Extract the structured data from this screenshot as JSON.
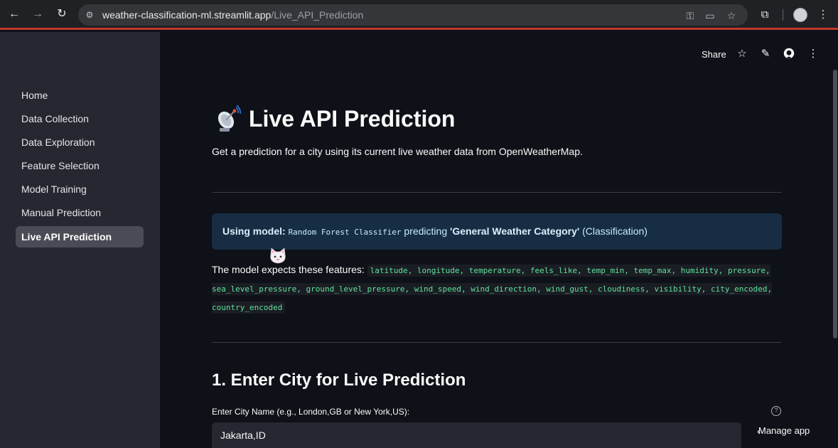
{
  "browser": {
    "url_host": "weather-classification-ml.streamlit.app",
    "url_path": "/Live_API_Prediction"
  },
  "sidebar": {
    "items": [
      {
        "label": "Home"
      },
      {
        "label": "Data Collection"
      },
      {
        "label": "Data Exploration"
      },
      {
        "label": "Feature Selection"
      },
      {
        "label": "Model Training"
      },
      {
        "label": "Manual Prediction"
      },
      {
        "label": "Live API Prediction",
        "active": true
      }
    ]
  },
  "toolbar": {
    "share_label": "Share",
    "icons": [
      "star-icon",
      "edit-icon",
      "github-icon",
      "more-icon"
    ]
  },
  "main": {
    "title": "Live API Prediction",
    "subtitle": "Get a prediction for a city using its current live weather data from OpenWeatherMap.",
    "info": {
      "prefix": "Using model:",
      "model": "Random Forest Classifier",
      "middle": "predicting",
      "target": "'General Weather Category'",
      "suffix": "(Classification)"
    },
    "features_label": "The model expects these features:",
    "features": "latitude, longitude, temperature, feels_like, temp_min, temp_max, humidity, pressure, sea_level_pressure, ground_level_pressure, wind_speed, wind_direction, wind_gust, cloudiness, visibility, city_encoded, country_encoded",
    "section_title": "1. Enter City for Live Prediction",
    "input_label": "Enter City Name (e.g., London,GB or New York,US):",
    "input_value": "Jakarta,ID"
  },
  "manage_app_label": "Manage app",
  "colors": {
    "sidebar_bg": "#262730",
    "main_bg": "#0e1117",
    "info_bg": "#172d43",
    "code_green": "#5fe29b",
    "chrome_accent": "#c0392b"
  }
}
